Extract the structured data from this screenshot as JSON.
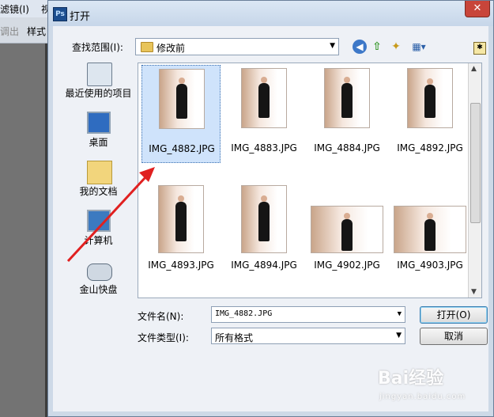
{
  "background_app": {
    "menu": [
      "滤镜(I)",
      "视"
    ],
    "toolbar": [
      "调出",
      "样式"
    ]
  },
  "dialog": {
    "title": "打开",
    "close_icon": "close-icon",
    "look_in_label": "查找范围(I):",
    "look_in_value": "修改前",
    "toolbar_icons": [
      "back-icon",
      "up-folder-icon",
      "new-folder-icon",
      "view-menu-icon",
      "extra-icon"
    ]
  },
  "places": [
    {
      "label": "最近使用的项目",
      "icon": "recent-items-icon"
    },
    {
      "label": "桌面",
      "icon": "desktop-icon"
    },
    {
      "label": "我的文档",
      "icon": "my-documents-icon"
    },
    {
      "label": "计算机",
      "icon": "computer-icon"
    },
    {
      "label": "金山快盘",
      "icon": "kuaipan-drive-icon"
    }
  ],
  "files": [
    {
      "name": "IMG_4882.JPG",
      "selected": true
    },
    {
      "name": "IMG_4883.JPG",
      "selected": false
    },
    {
      "name": "IMG_4884.JPG",
      "selected": false
    },
    {
      "name": "IMG_4892.JPG",
      "selected": false
    },
    {
      "name": "IMG_4893.JPG",
      "selected": false
    },
    {
      "name": "IMG_4894.JPG",
      "selected": false
    },
    {
      "name": "IMG_4902.JPG",
      "selected": false
    },
    {
      "name": "IMG_4903.JPG",
      "selected": false
    }
  ],
  "file_name_label": "文件名(N):",
  "file_name_value": "IMG_4882.JPG",
  "file_type_label": "文件类型(I):",
  "file_type_value": "所有格式",
  "open_button": "打开(O)",
  "cancel_button": "取消",
  "annotation": {
    "color": "#e02020"
  },
  "watermark": {
    "text": "Bai经验",
    "sub": "jingyan.baidu.com"
  }
}
